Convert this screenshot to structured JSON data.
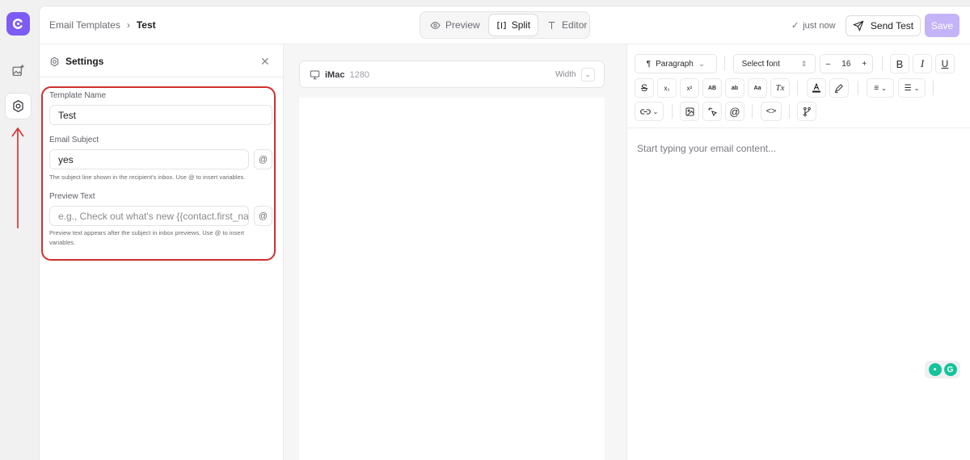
{
  "breadcrumb": {
    "parent": "Email Templates",
    "current": "Test"
  },
  "view_toggle": {
    "preview": "Preview",
    "split": "Split",
    "editor": "Editor",
    "active": "split"
  },
  "status": {
    "saved_text": "just now"
  },
  "actions": {
    "send_test": "Send Test",
    "save": "Save"
  },
  "settings": {
    "title": "Settings",
    "template_name_label": "Template Name",
    "template_name_value": "Test",
    "email_subject_label": "Email Subject",
    "email_subject_value": "yes",
    "email_subject_hint": "The subject line shown in the recipient's inbox. Use @ to insert variables.",
    "preview_text_label": "Preview Text",
    "preview_text_placeholder": "e.g., Check out what's new {{contact.first_name}}",
    "preview_text_hint": "Preview text appears after the subject in inbox previews. Use @ to insert variables.",
    "at_symbol": "@"
  },
  "device": {
    "name": "iMac",
    "width_value": "1280",
    "width_label": "Width"
  },
  "toolbar": {
    "paragraph": "Paragraph",
    "font": "Select font",
    "font_size": "16",
    "minus": "–",
    "plus": "+"
  },
  "editor": {
    "placeholder": "Start typing your email content..."
  },
  "colors": {
    "brand": "#7c5cf2",
    "save_disabled": "#c4b3f7",
    "annotation": "#cf2f2f"
  }
}
